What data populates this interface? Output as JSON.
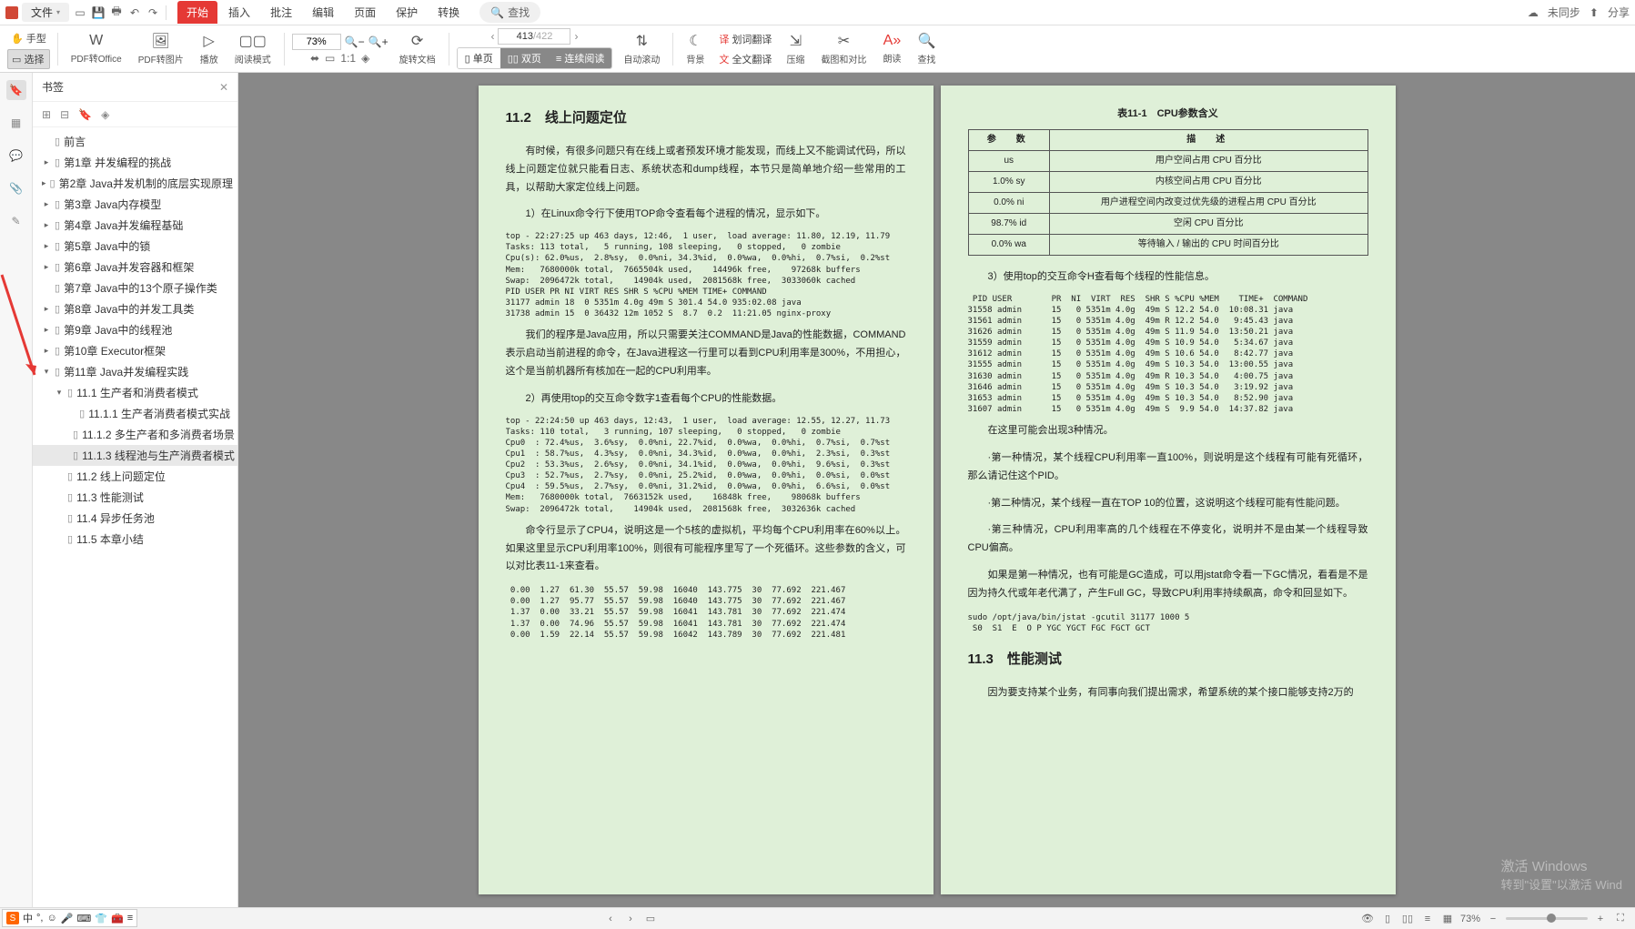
{
  "menubar": {
    "file": "文件",
    "search": "查找",
    "sync": "未同步",
    "share": "分享",
    "tabs": [
      "开始",
      "插入",
      "批注",
      "编辑",
      "页面",
      "保护",
      "转换"
    ]
  },
  "ribbon": {
    "left_hand": "手型",
    "left_select": "选择",
    "pdf_office": "PDF转Office",
    "pdf_image": "PDF转图片",
    "play": "播放",
    "read_mode": "阅读模式",
    "zoom": "73%",
    "rotate": "旋转文档",
    "page_current": "413",
    "page_total": "/422",
    "single": "单页",
    "double": "双页",
    "continuous": "连续阅读",
    "auto_scroll": "自动滚动",
    "bg": "背景",
    "word_trans": "划词翻译",
    "full_trans": "全文翻译",
    "compress": "压缩",
    "compare": "截图和对比",
    "read_aloud": "朗读",
    "find": "查找"
  },
  "sidebar": {
    "title": "书签",
    "items": [
      {
        "label": "前言",
        "exp": "",
        "ind": 0
      },
      {
        "label": "第1章 并发编程的挑战",
        "exp": "▸",
        "ind": 0
      },
      {
        "label": "第2章 Java并发机制的底层实现原理",
        "exp": "▸",
        "ind": 0
      },
      {
        "label": "第3章 Java内存模型",
        "exp": "▸",
        "ind": 0
      },
      {
        "label": "第4章 Java并发编程基础",
        "exp": "▸",
        "ind": 0
      },
      {
        "label": "第5章 Java中的锁",
        "exp": "▸",
        "ind": 0
      },
      {
        "label": "第6章 Java并发容器和框架",
        "exp": "▸",
        "ind": 0
      },
      {
        "label": "第7章 Java中的13个原子操作类",
        "exp": "",
        "ind": 0,
        "clip": true
      },
      {
        "label": "第8章 Java中的并发工具类",
        "exp": "▸",
        "ind": 0
      },
      {
        "label": "第9章 Java中的线程池",
        "exp": "▸",
        "ind": 0
      },
      {
        "label": "第10章 Executor框架",
        "exp": "▸",
        "ind": 0
      },
      {
        "label": "第11章 Java并发编程实践",
        "exp": "▾",
        "ind": 0
      },
      {
        "label": "11.1 生产者和消费者模式",
        "exp": "▾",
        "ind": 1
      },
      {
        "label": "11.1.1 生产者消费者模式实战",
        "exp": "",
        "ind": 2
      },
      {
        "label": "11.1.2 多生产者和多消费者场景",
        "exp": "",
        "ind": 2
      },
      {
        "label": "11.1.3 线程池与生产消费者模式",
        "exp": "",
        "ind": 2,
        "sel": true
      },
      {
        "label": "11.2 线上问题定位",
        "exp": "",
        "ind": 1
      },
      {
        "label": "11.3 性能测试",
        "exp": "",
        "ind": 1
      },
      {
        "label": "11.4 异步任务池",
        "exp": "",
        "ind": 1
      },
      {
        "label": "11.5 本章小结",
        "exp": "",
        "ind": 1
      }
    ]
  },
  "doc": {
    "left": {
      "heading": "11.2　线上问题定位",
      "p1": "有时候，有很多问题只有在线上或者预发环境才能发现，而线上又不能调试代码，所以线上问题定位就只能看日志、系统状态和dump线程，本节只是简单地介绍一些常用的工具，以帮助大家定位线上问题。",
      "n1": "1）在Linux命令行下使用TOP命令查看每个进程的情况，显示如下。",
      "code1": "top - 22:27:25 up 463 days, 12:46,  1 user,  load average: 11.80, 12.19, 11.79\nTasks: 113 total,   5 running, 108 sleeping,   0 stopped,   0 zombie\nCpu(s): 62.0%us,  2.8%sy,  0.0%ni, 34.3%id,  0.0%wa,  0.0%hi,  0.7%si,  0.2%st\nMem:   7680000k total,  7665504k used,    14496k free,    97268k buffers\nSwap:  2096472k total,    14904k used,  2081568k free,  3033060k cached\nPID USER PR NI VIRT RES SHR S %CPU %MEM TIME+ COMMAND\n31177 admin 18  0 5351m 4.0g 49m S 301.4 54.0 935:02.08 java\n31738 admin 15  0 36432 12m 1052 S  8.7  0.2  11:21.05 nginx-proxy",
      "p2": "我们的程序是Java应用，所以只需要关注COMMAND是Java的性能数据，COMMAND表示启动当前进程的命令，在Java进程这一行里可以看到CPU利用率是300%，不用担心，这个是当前机器所有核加在一起的CPU利用率。",
      "n2": "2）再使用top的交互命令数字1查看每个CPU的性能数据。",
      "code2": "top - 22:24:50 up 463 days, 12:43,  1 user,  load average: 12.55, 12.27, 11.73\nTasks: 110 total,   3 running, 107 sleeping,   0 stopped,   0 zombie\nCpu0  : 72.4%us,  3.6%sy,  0.0%ni, 22.7%id,  0.0%wa,  0.0%hi,  0.7%si,  0.7%st\nCpu1  : 58.7%us,  4.3%sy,  0.0%ni, 34.3%id,  0.0%wa,  0.0%hi,  2.3%si,  0.3%st\nCpu2  : 53.3%us,  2.6%sy,  0.0%ni, 34.1%id,  0.0%wa,  0.0%hi,  9.6%si,  0.3%st\nCpu3  : 52.7%us,  2.7%sy,  0.0%ni, 25.2%id,  0.0%wa,  0.0%hi,  0.0%si,  0.0%st\nCpu4  : 59.5%us,  2.7%sy,  0.0%ni, 31.2%id,  0.0%wa,  0.0%hi,  6.6%si,  0.0%st\nMem:   7680000k total,  7663152k used,    16848k free,    98068k buffers\nSwap:  2096472k total,    14904k used,  2081568k free,  3032636k cached",
      "p3": "命令行显示了CPU4，说明这是一个5核的虚拟机，平均每个CPU利用率在60%以上。如果这里显示CPU利用率100%，则很有可能程序里写了一个死循环。这些参数的含义，可以对比表11-1来查看。",
      "code3": " 0.00  1.27  61.30  55.57  59.98  16040  143.775  30  77.692  221.467\n 0.00  1.27  95.77  55.57  59.98  16040  143.775  30  77.692  221.467\n 1.37  0.00  33.21  55.57  59.98  16041  143.781  30  77.692  221.474\n 1.37  0.00  74.96  55.57  59.98  16041  143.781  30  77.692  221.474\n 0.00  1.59  22.14  55.57  59.98  16042  143.789  30  77.692  221.481"
    },
    "right": {
      "table_caption": "表11-1　CPU参数含义",
      "table_head": [
        "参　数",
        "描　述"
      ],
      "table_rows": [
        [
          "us",
          "用户空间占用 CPU 百分比"
        ],
        [
          "1.0% sy",
          "内核空间占用 CPU 百分比"
        ],
        [
          "0.0% ni",
          "用户进程空间内改变过优先级的进程占用 CPU 百分比"
        ],
        [
          "98.7% id",
          "空闲 CPU 百分比"
        ],
        [
          "0.0% wa",
          "等待输入 / 输出的 CPU 时间百分比"
        ]
      ],
      "n3": "3）使用top的交互命令H查看每个线程的性能信息。",
      "code_top": " PID USER        PR  NI  VIRT  RES  SHR S %CPU %MEM    TIME+  COMMAND\n31558 admin      15   0 5351m 4.0g  49m S 12.2 54.0  10:08.31 java\n31561 admin      15   0 5351m 4.0g  49m R 12.2 54.0   9:45.43 java\n31626 admin      15   0 5351m 4.0g  49m S 11.9 54.0  13:50.21 java\n31559 admin      15   0 5351m 4.0g  49m S 10.9 54.0   5:34.67 java\n31612 admin      15   0 5351m 4.0g  49m S 10.6 54.0   8:42.77 java\n31555 admin      15   0 5351m 4.0g  49m S 10.3 54.0  13:00.55 java\n31630 admin      15   0 5351m 4.0g  49m R 10.3 54.0   4:00.75 java\n31646 admin      15   0 5351m 4.0g  49m S 10.3 54.0   3:19.92 java\n31653 admin      15   0 5351m 4.0g  49m S 10.3 54.0   8:52.90 java\n31607 admin      15   0 5351m 4.0g  49m S  9.9 54.0  14:37.82 java",
      "p4": "在这里可能会出现3种情况。",
      "p5": "·第一种情况，某个线程CPU利用率一直100%，则说明是这个线程有可能有死循环，那么请记住这个PID。",
      "p6": "·第二种情况，某个线程一直在TOP 10的位置，这说明这个线程可能有性能问题。",
      "p7": "·第三种情况，CPU利用率高的几个线程在不停变化，说明并不是由某一个线程导致CPU偏高。",
      "p8": "如果是第一种情况，也有可能是GC造成，可以用jstat命令看一下GC情况，看看是不是因为持久代或年老代满了，产生Full GC，导致CPU利用率持续飙高，命令和回显如下。",
      "code_jstat": "sudo /opt/java/bin/jstat -gcutil 31177 1000 5\n S0  S1  E  O P YGC YGCT FGC FGCT GCT",
      "heading2": "11.3　性能测试",
      "p9": "因为要支持某个业务，有同事向我们提出需求，希望系统的某个接口能够支持2万的"
    }
  },
  "watermark": {
    "l1": "激活 Windows",
    "l2": "转到\"设置\"以激活 Wind"
  },
  "status": {
    "zoom": "73%"
  },
  "ime": {
    "lang": "中"
  }
}
